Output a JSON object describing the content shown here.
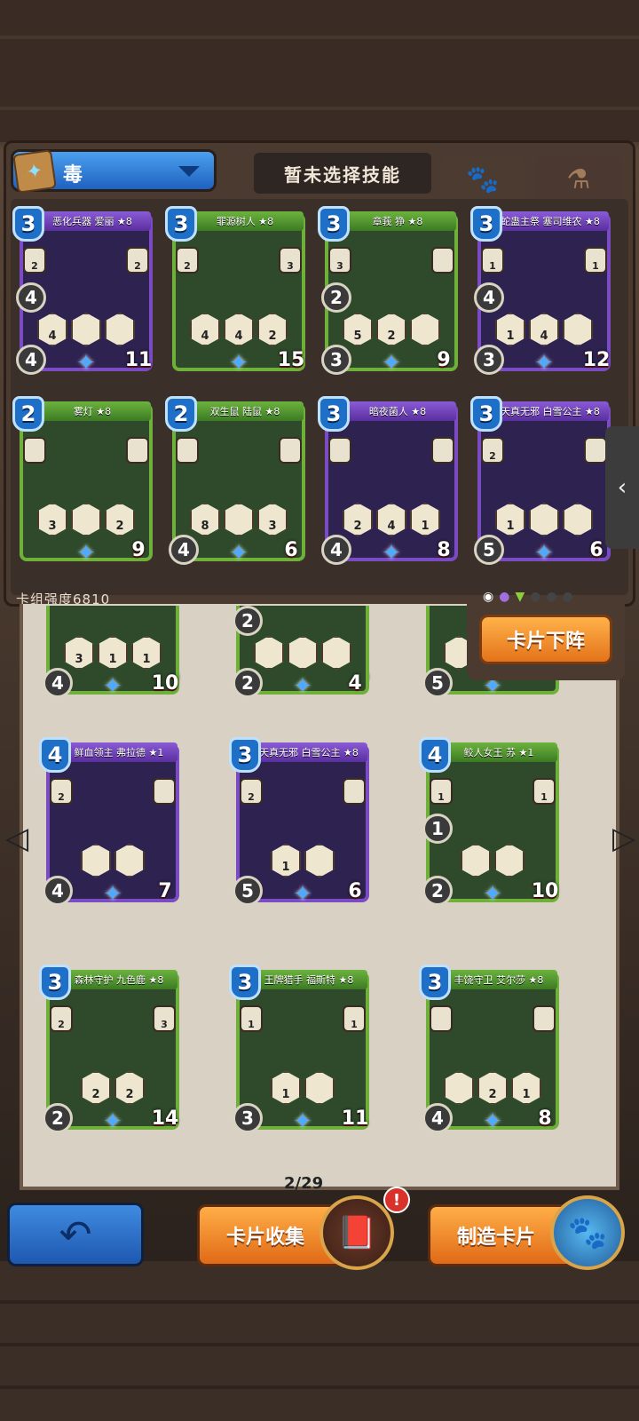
{
  "header": {
    "skill_dropdown_label": "毒",
    "no_skill_label": "暂未选择技能"
  },
  "deck": {
    "strength_label": "卡组强度6810",
    "cards": [
      {
        "name": "恶化兵器 爱丽 ★8",
        "cost": "3",
        "left": "2",
        "right": "2",
        "hex": [
          "4",
          "",
          ""
        ],
        "spd": "4",
        "atk": "4",
        "hp": "11"
      },
      {
        "name": "罪源树人 ★8",
        "cost": "3",
        "left": "2",
        "right": "3",
        "hex": [
          "4",
          "4",
          "2"
        ],
        "spd": "",
        "atk": "",
        "hp": "15"
      },
      {
        "name": "章莪 狰 ★8",
        "cost": "3",
        "left": "3",
        "right": "",
        "hex": [
          "5",
          "2",
          ""
        ],
        "spd": "2",
        "atk": "3",
        "hp": "9"
      },
      {
        "name": "蛇蛊主祭 塞司维农 ★8",
        "cost": "3",
        "left": "1",
        "right": "1",
        "hex": [
          "1",
          "4",
          ""
        ],
        "spd": "4",
        "atk": "3",
        "hp": "12"
      },
      {
        "name": "雾灯 ★8",
        "cost": "2",
        "left": "",
        "right": "",
        "hex": [
          "3",
          "",
          "2"
        ],
        "spd": "",
        "atk": "",
        "hp": "9"
      },
      {
        "name": "双生鼠 陆鼠 ★8",
        "cost": "2",
        "left": "",
        "right": "",
        "hex": [
          "8",
          "",
          "3"
        ],
        "spd": "",
        "atk": "4",
        "hp": "6"
      },
      {
        "name": "暗夜菌人 ★8",
        "cost": "3",
        "left": "",
        "right": "",
        "hex": [
          "2",
          "4",
          "1"
        ],
        "spd": "",
        "atk": "4",
        "hp": "8"
      },
      {
        "name": "天真无邪 白雪公主 ★8",
        "cost": "3",
        "left": "2",
        "right": "",
        "hex": [
          "1",
          "",
          ""
        ],
        "spd": "",
        "atk": "5",
        "hp": "6"
      }
    ]
  },
  "collection": {
    "remove_button": "卡片下阵",
    "partial_row": [
      {
        "hex": [
          "3",
          "1",
          "1"
        ],
        "atk": "4",
        "hp": "10"
      },
      {
        "hex": [
          "",
          "",
          ""
        ],
        "spd": "2",
        "atk": "2",
        "hp": "4"
      },
      {
        "hex": [
          "",
          "",
          ""
        ],
        "atk": "5",
        "hp": ""
      }
    ],
    "cards": [
      {
        "name": "鲜血领主 弗拉德 ★1",
        "cost": "4",
        "left": "2",
        "right": "",
        "hex": [
          "",
          ""
        ],
        "spd": "",
        "atk": "4",
        "hp": "7"
      },
      {
        "name": "天真无邪 白雪公主 ★8",
        "cost": "3",
        "left": "2",
        "right": "",
        "hex": [
          "1",
          ""
        ],
        "spd": "",
        "atk": "5",
        "hp": "6"
      },
      {
        "name": "鲛人女王 苏 ★1",
        "cost": "4",
        "left": "1",
        "right": "1",
        "hex": [
          "",
          ""
        ],
        "spd": "1",
        "atk": "2",
        "hp": "10"
      },
      {
        "name": "森林守护 九色鹿 ★8",
        "cost": "3",
        "left": "2",
        "right": "3",
        "hex": [
          "2",
          "2"
        ],
        "spd": "",
        "atk": "2",
        "hp": "14"
      },
      {
        "name": "王牌猎手 福斯特 ★8",
        "cost": "3",
        "left": "1",
        "right": "1",
        "hex": [
          "1",
          ""
        ],
        "spd": "",
        "atk": "3",
        "hp": "11"
      },
      {
        "name": "丰饶守卫 艾尔莎 ★8",
        "cost": "3",
        "left": "",
        "right": "",
        "hex": [
          "",
          "2",
          "1"
        ],
        "spd": "",
        "atk": "4",
        "hp": "8"
      }
    ],
    "page_count": "2/29"
  },
  "footer": {
    "collect_label": "卡片收集",
    "craft_label": "制造卡片",
    "alert": "!"
  }
}
